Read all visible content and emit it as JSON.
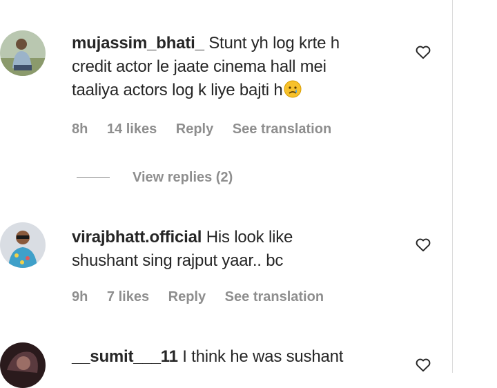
{
  "comments": [
    {
      "username": "mujassim_bhati_",
      "lines": [
        "Stunt yh log krte h",
        "credit actor le jaate cinema hall mei",
        "taaliya actors log k liye bajti h"
      ],
      "emoji": "crying-face-emoji",
      "time": "8h",
      "likes": "14 likes",
      "reply": "Reply",
      "translate": "See translation",
      "view_replies": "View replies (2)"
    },
    {
      "username": "virajbhatt.official",
      "lines": [
        "His look like",
        "shushant sing rajput yaar.. bc"
      ],
      "time": "9h",
      "likes": "7 likes",
      "reply": "Reply",
      "translate": "See translation"
    },
    {
      "username": "__sumit___11",
      "lines": [
        "I think he was sushant"
      ]
    }
  ],
  "colors": {
    "text": "#262626",
    "secondary": "#8e8e8e",
    "divider": "#dbdbdb"
  }
}
